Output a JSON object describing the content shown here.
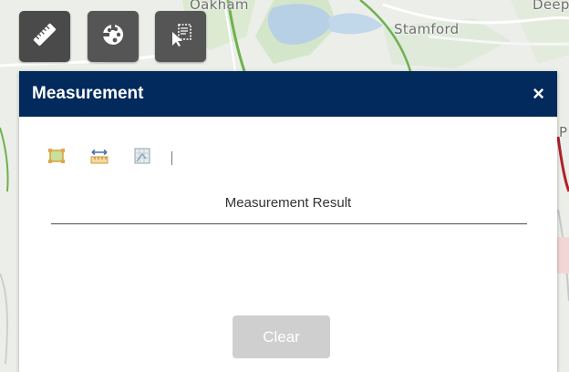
{
  "map": {
    "labels": [
      "Oakham",
      "Stamford",
      "Deep",
      "P"
    ]
  },
  "toolbar": {
    "buttons": [
      {
        "icon": "ruler-icon",
        "active": true
      },
      {
        "icon": "palette-icon",
        "active": false
      },
      {
        "icon": "select-draw-icon",
        "active": false
      }
    ]
  },
  "panel": {
    "title": "Measurement",
    "close_label": "×",
    "modes": [
      "area-measure-icon",
      "distance-measure-icon",
      "location-measure-icon"
    ],
    "result_label": "Measurement Result",
    "clear_label": "Clear"
  },
  "colors": {
    "header": "#022a5c",
    "toolbar_button": "#555555",
    "clear_disabled": "#cfcfcf"
  }
}
